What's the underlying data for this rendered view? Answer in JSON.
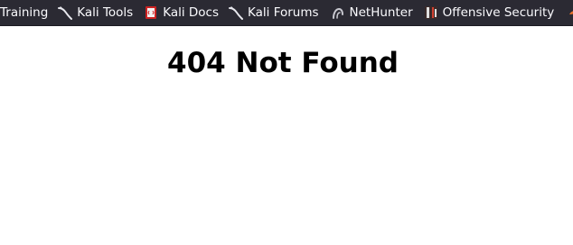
{
  "bookmarks": [
    {
      "label": "Training",
      "icon": "none"
    },
    {
      "label": "Kali Tools",
      "icon": "kali-dragon-icon"
    },
    {
      "label": "Kali Docs",
      "icon": "kali-docs-icon"
    },
    {
      "label": "Kali Forums",
      "icon": "kali-dragon-icon"
    },
    {
      "label": "NetHunter",
      "icon": "nethunter-icon"
    },
    {
      "label": "Offensive Security",
      "icon": "offsec-icon"
    },
    {
      "label": "",
      "icon": "exploit-db-icon"
    }
  ],
  "colors": {
    "bookmarks_bar_bg": "#2b2a33",
    "bookmark_text": "#fbfbfe",
    "page_bg": "#ffffff",
    "docs_icon_red": "#cc2222"
  },
  "page": {
    "heading": "404 Not Found"
  }
}
